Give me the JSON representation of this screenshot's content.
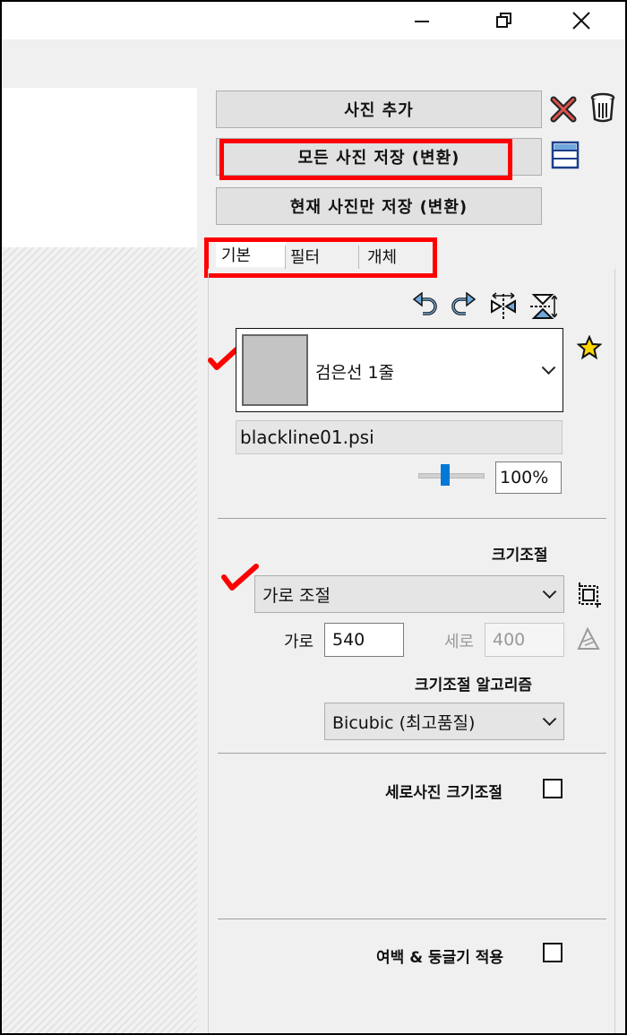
{
  "window": {
    "minimize": "—",
    "maximize": "❐",
    "close": "✕"
  },
  "buttons": {
    "add_photo": "사진 추가",
    "save_all": "모든 사진 저장 (변환)",
    "save_current": "현재 사진만 저장 (변환)"
  },
  "tabs": [
    "기본",
    "필터",
    "개체"
  ],
  "frame": {
    "name": "검은선 1줄",
    "file": "blackline01.psi",
    "opacity": "100%",
    "opacity_level": 0.4
  },
  "resize": {
    "title": "크기조절",
    "mode": "가로 조절",
    "width_label": "가로",
    "width_value": "540",
    "height_label": "세로",
    "height_value": "400",
    "algorithm_title": "크기조절 알고리즘",
    "algorithm": "Bicubic (최고품질)"
  },
  "options": {
    "portrait_resize": "세로사진 크기조절",
    "margin_round": "여백 & 둥글기 적용"
  },
  "icons": [
    "close-x-icon",
    "trash-icon",
    "list-icon",
    "rotate-left-icon",
    "rotate-right-icon",
    "flip-horizontal-icon",
    "flip-vertical-icon",
    "star-icon",
    "crop-icon",
    "ruler-icon"
  ],
  "colors": {
    "highlight": "#ff0000",
    "accent": "#0078d7"
  }
}
